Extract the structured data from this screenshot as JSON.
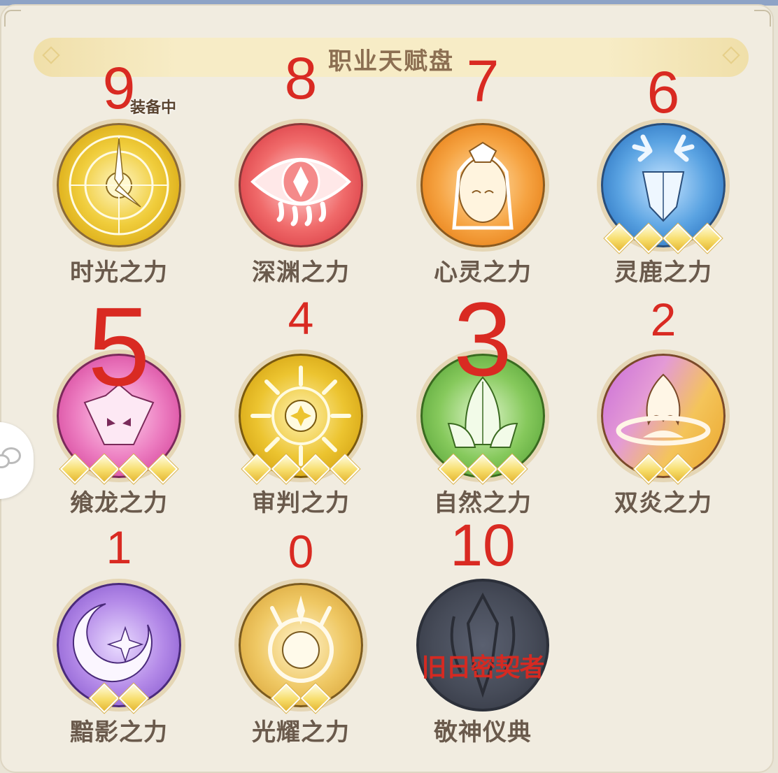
{
  "panel": {
    "title": "职业天赋盘"
  },
  "talents": [
    {
      "number": "9",
      "label": "时光之力",
      "gems": 0,
      "equipped_tag": "装备中",
      "color": "#e3b81c",
      "icon": "clock-icon"
    },
    {
      "number": "8",
      "label": "深渊之力",
      "gems": 0,
      "color": "#e8444c",
      "icon": "eye-icon"
    },
    {
      "number": "7",
      "label": "心灵之力",
      "gems": 0,
      "color": "#f08a1e",
      "icon": "goddess-icon"
    },
    {
      "number": "6",
      "label": "灵鹿之力",
      "gems": 4,
      "color": "#2f7fc8",
      "icon": "deer-icon"
    },
    {
      "number": "5",
      "label": "飨龙之力",
      "gems": 4,
      "color": "#d94ea0",
      "icon": "dragon-icon"
    },
    {
      "number": "4",
      "label": "审判之力",
      "gems": 4,
      "color": "#e0b418",
      "icon": "sun-icon"
    },
    {
      "number": "3",
      "label": "自然之力",
      "gems": 3,
      "color": "#6cb548",
      "icon": "lotus-icon"
    },
    {
      "number": "2",
      "label": "双炎之力",
      "gems": 2,
      "color": "#e6a63a",
      "icon": "flame-icon"
    },
    {
      "number": "1",
      "label": "黯影之力",
      "gems": 2,
      "color": "#a06ad8",
      "icon": "moon-icon"
    },
    {
      "number": "0",
      "label": "光耀之力",
      "gems": 2,
      "color": "#e6b84a",
      "icon": "radiance-icon"
    },
    {
      "number": "10",
      "label": "敬神仪典",
      "gems": 0,
      "locked_text": "旧日密契者",
      "color": "#3e4350",
      "icon": "dark-relic-icon"
    }
  ]
}
